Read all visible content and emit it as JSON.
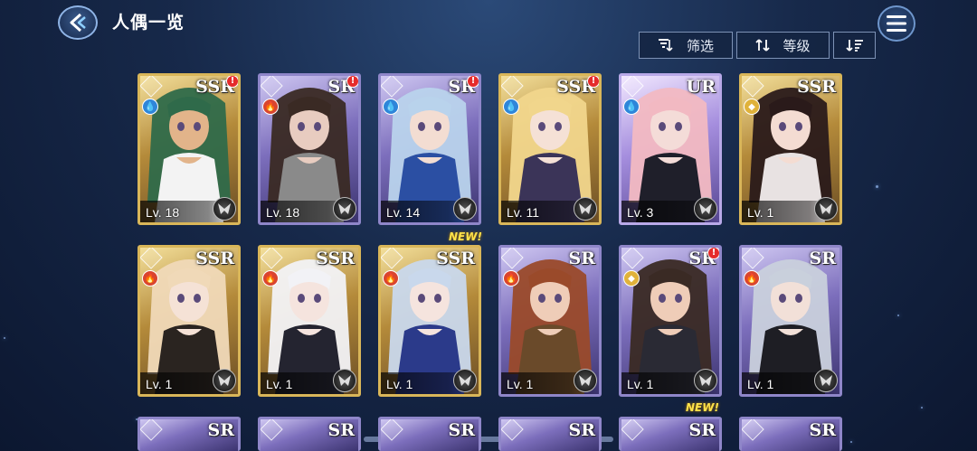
{
  "header": {
    "title": "人偶一览",
    "back_icon": "back-arrow-icon",
    "menu_icon": "hamburger-menu-icon"
  },
  "toolbar": {
    "filter_label": "筛选",
    "sort_label": "等级",
    "filter_icon": "filter-icon",
    "sort_icon": "sort-arrows-icon",
    "order_icon": "sort-order-icon"
  },
  "colors": {
    "ssr": "#d9b659",
    "sr": "#8f86c9",
    "ur": "#b9a9e8",
    "alert": "#e52b2b",
    "new": "#ffe24a"
  },
  "cards": [
    {
      "rarity": "SSR",
      "element": "water",
      "level": "Lv. 18",
      "alert": true,
      "new": false,
      "hair": "#2f6a4a",
      "skin": "#e2b48a",
      "outfit": "#f3f3f3"
    },
    {
      "rarity": "SR",
      "element": "fire",
      "level": "Lv. 18",
      "alert": true,
      "new": false,
      "hair": "#3a2a24",
      "skin": "#e8ccc0",
      "outfit": "#8a8a8a"
    },
    {
      "rarity": "SR",
      "element": "water",
      "level": "Lv. 14",
      "alert": true,
      "new": false,
      "hair": "#b9d3ec",
      "skin": "#f3ddd2",
      "outfit": "#2b4fa3"
    },
    {
      "rarity": "SSR",
      "element": "water",
      "level": "Lv. 11",
      "alert": true,
      "new": false,
      "hair": "#f1d68c",
      "skin": "#f5e1d6",
      "outfit": "#3b3458"
    },
    {
      "rarity": "UR",
      "element": "water",
      "level": "Lv. 3",
      "alert": false,
      "new": false,
      "hair": "#f2b9c2",
      "skin": "#f4dcd8",
      "outfit": "#1f1f2a"
    },
    {
      "rarity": "SSR",
      "element": "light",
      "level": "Lv. 1",
      "alert": false,
      "new": false,
      "hair": "#2a1a1a",
      "skin": "#f4dcd2",
      "outfit": "#e8e2e2"
    },
    {
      "rarity": "SSR",
      "element": "fire",
      "level": "Lv. 1",
      "alert": false,
      "new": false,
      "hair": "#f0d9b8",
      "skin": "#f5e2d6",
      "outfit": "#2a2420"
    },
    {
      "rarity": "SSR",
      "element": "fire",
      "level": "Lv. 1",
      "alert": false,
      "new": false,
      "hair": "#f2f2f6",
      "skin": "#f5e4de",
      "outfit": "#242430"
    },
    {
      "rarity": "SSR",
      "element": "fire",
      "level": "Lv. 1",
      "alert": false,
      "new": true,
      "hair": "#c9d8ec",
      "skin": "#f5e4de",
      "outfit": "#2b3a8a"
    },
    {
      "rarity": "SR",
      "element": "fire",
      "level": "Lv. 1",
      "alert": false,
      "new": false,
      "hair": "#9a4a2a",
      "skin": "#efcdb8",
      "outfit": "#6a4a2a"
    },
    {
      "rarity": "SR",
      "element": "light",
      "level": "Lv. 1",
      "alert": true,
      "new": false,
      "hair": "#3a2a24",
      "skin": "#efcdb8",
      "outfit": "#2a2a34"
    },
    {
      "rarity": "SR",
      "element": "fire",
      "level": "Lv. 1",
      "alert": false,
      "new": false,
      "hair": "#c9d0dc",
      "skin": "#f2e0d8",
      "outfit": "#1e1e24"
    }
  ],
  "partial_row": [
    {
      "rarity": "SR",
      "new": false
    },
    {
      "rarity": "SR",
      "new": false
    },
    {
      "rarity": "SR",
      "new": false
    },
    {
      "rarity": "SR",
      "new": false
    },
    {
      "rarity": "SR",
      "new": true
    },
    {
      "rarity": "SR",
      "new": false
    }
  ],
  "new_label": "NEW!"
}
